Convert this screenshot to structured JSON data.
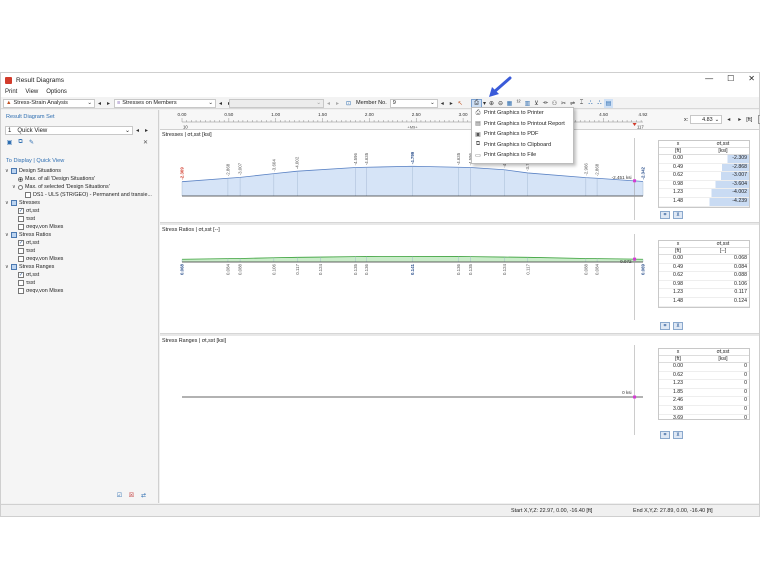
{
  "window": {
    "title": "Result Diagrams",
    "minimize": "—",
    "maximize": "☐",
    "close": "✕"
  },
  "menu": [
    "Print",
    "View",
    "Options"
  ],
  "toolbar": {
    "analysis_combo": "Stress-Strain Analysis",
    "stress_combo": "Stresses on Members",
    "member_label": "Member No.",
    "member_value": "9"
  },
  "dropdown": {
    "items": [
      {
        "label": "Print Graphics to Printer",
        "icon": "printer-icon"
      },
      {
        "label": "Print Graphics to Printout Report",
        "icon": "report-icon"
      },
      {
        "label": "Print Graphics to PDF",
        "icon": "pdf-icon"
      },
      {
        "label": "Print Graphics to Clipboard",
        "icon": "clipboard-icon"
      },
      {
        "label": "Print Graphics to File",
        "icon": "file-icon"
      }
    ]
  },
  "left": {
    "set_title": "Result Diagram Set",
    "set_value": "Quick View",
    "set_number": "1",
    "display_title": "To Display | Quick View",
    "tree": [
      {
        "label": "Design Situations",
        "level": 0,
        "type": "check",
        "state": "partial",
        "exp": "∨"
      },
      {
        "label": "Max. of all 'Design Situations'",
        "level": 1,
        "type": "radio",
        "state": "on"
      },
      {
        "label": "Max. of selected 'Design Situations'",
        "level": 1,
        "type": "radio",
        "state": "off",
        "exp": "∨"
      },
      {
        "label": "DS1 - ULS (STR/GEO) - Permanent and transie...",
        "level": 2,
        "type": "check",
        "state": "off"
      },
      {
        "label": "Stresses",
        "level": 0,
        "type": "check",
        "state": "partial",
        "exp": "∨"
      },
      {
        "label": "σt,sst",
        "level": 1,
        "type": "check",
        "state": "on"
      },
      {
        "label": "τsst",
        "level": 1,
        "type": "check",
        "state": "off"
      },
      {
        "label": "σeqv,von Mises",
        "level": 1,
        "type": "check",
        "state": "off"
      },
      {
        "label": "Stress Ratios",
        "level": 0,
        "type": "check",
        "state": "partial",
        "exp": "∨"
      },
      {
        "label": "σt,sst",
        "level": 1,
        "type": "check",
        "state": "on"
      },
      {
        "label": "τsst",
        "level": 1,
        "type": "check",
        "state": "off"
      },
      {
        "label": "σeqv,von Mises",
        "level": 1,
        "type": "check",
        "state": "off"
      },
      {
        "label": "Stress Ranges",
        "level": 0,
        "type": "check",
        "state": "partial",
        "exp": "∨"
      },
      {
        "label": "σt,sst",
        "level": 1,
        "type": "check",
        "state": "on"
      },
      {
        "label": "τsst",
        "level": 1,
        "type": "check",
        "state": "off"
      },
      {
        "label": "σeqv,von Mises",
        "level": 1,
        "type": "check",
        "state": "off"
      }
    ]
  },
  "ruler": {
    "ticks": [
      "0.00",
      "0.50",
      "1.00",
      "1.50",
      "2.00",
      "2.50",
      "3.00",
      "3.50",
      "4.00",
      "4.50",
      "4.92"
    ],
    "x_label": "x:",
    "x_value": "4.83",
    "unit": "[ft]",
    "start_node": "10",
    "end_node": "117",
    "member_mark": "+M9+"
  },
  "panels": [
    {
      "title": "Stresses | σt,sst [ksi]",
      "end_label": "-2.451 ksi",
      "table": {
        "col1": "x",
        "col1_unit": "[ft]",
        "col2": "σt,sst",
        "col2_unit": "[ksi]",
        "rows": [
          [
            "0.00",
            "-2.309"
          ],
          [
            "0.49",
            "-2.868"
          ],
          [
            "0.62",
            "-3.007"
          ],
          [
            "0.98",
            "-3.604"
          ],
          [
            "1.23",
            "-4.002"
          ],
          [
            "1.48",
            "-4.239"
          ],
          [
            "1.85",
            "-4.596"
          ],
          [
            "1.97",
            "-4.635"
          ],
          [
            "2.46",
            "-4.799"
          ]
        ]
      }
    },
    {
      "title": "Stress Ratios | σt,sst [--]",
      "end_label": "0.072",
      "table": {
        "col1": "x",
        "col1_unit": "[ft]",
        "col2": "σt,sst",
        "col2_unit": "[--]",
        "rows": [
          [
            "0.00",
            "0.068"
          ],
          [
            "0.49",
            "0.084"
          ],
          [
            "0.62",
            "0.088"
          ],
          [
            "0.98",
            "0.106"
          ],
          [
            "1.23",
            "0.117"
          ],
          [
            "1.48",
            "0.124"
          ],
          [
            "1.85",
            "0.135"
          ],
          [
            "1.97",
            "0.136"
          ],
          [
            "2.46",
            "0.141"
          ]
        ]
      }
    },
    {
      "title": "Stress Ranges | σt,sst [ksi]",
      "end_label": "0 ksi",
      "table": {
        "col1": "x",
        "col1_unit": "[ft]",
        "col2": "σt,sst",
        "col2_unit": "[ksi]",
        "rows": [
          [
            "0.00",
            "0"
          ],
          [
            "0.62",
            "0"
          ],
          [
            "1.23",
            "0"
          ],
          [
            "1.85",
            "0"
          ],
          [
            "2.46",
            "0"
          ],
          [
            "3.08",
            "0"
          ],
          [
            "3.69",
            "0"
          ],
          [
            "4.31",
            "0"
          ],
          [
            "4.92",
            "0"
          ]
        ]
      }
    }
  ],
  "chart_data": [
    {
      "type": "area",
      "title": "Stresses | σt,sst [ksi]",
      "x": [
        0.0,
        0.49,
        0.62,
        0.98,
        1.23,
        1.85,
        1.97,
        2.46,
        2.95,
        3.08,
        3.44,
        3.69,
        4.31,
        4.43,
        4.92
      ],
      "labels": [
        "-2.309",
        "-2.868",
        "-3.007",
        "-3.604",
        "-4.002",
        "-4.596",
        "-4.635",
        "-4.799",
        "-4.635",
        "-4.596",
        "-4.239",
        "-3.717",
        "-2.966",
        "-2.868",
        "-2.342"
      ],
      "values": [
        -2.309,
        -2.868,
        -3.007,
        -3.604,
        -4.002,
        -4.596,
        -4.635,
        -4.799,
        -4.635,
        -4.596,
        -4.239,
        -3.717,
        -2.966,
        -2.868,
        -2.342
      ],
      "end_value": -2.451,
      "xlim": [
        0,
        4.92
      ],
      "colors": {
        "fill": "#d6e4f7",
        "line": "#5a82c4",
        "extreme": "#d23b2b"
      }
    },
    {
      "type": "area",
      "title": "Stress Ratios | σt,sst [--]",
      "x": [
        0.0,
        0.49,
        0.62,
        0.98,
        1.23,
        1.48,
        1.85,
        1.97,
        2.46,
        2.95,
        3.08,
        3.44,
        3.69,
        4.31,
        4.43,
        4.92
      ],
      "labels": [
        "0.068",
        "0.084",
        "0.088",
        "0.106",
        "0.117",
        "0.124",
        "0.135",
        "0.136",
        "0.141",
        "0.136",
        "0.135",
        "0.124",
        "0.117",
        "0.088",
        "0.084",
        "0.069"
      ],
      "values": [
        0.068,
        0.084,
        0.088,
        0.106,
        0.117,
        0.124,
        0.135,
        0.136,
        0.141,
        0.136,
        0.135,
        0.124,
        0.117,
        0.088,
        0.084,
        0.069
      ],
      "end_value": 0.072,
      "xlim": [
        0,
        4.92
      ],
      "colors": {
        "fill": "#c9ecc9",
        "line": "#3aa03a"
      }
    },
    {
      "type": "line",
      "title": "Stress Ranges | σt,sst [ksi]",
      "x": [
        0.0,
        4.92
      ],
      "values": [
        0,
        0
      ],
      "end_value": 0,
      "xlim": [
        0,
        4.92
      ]
    }
  ],
  "status": {
    "start": "Start X,Y,Z: 22.97, 0.00, -16.40 [ft]",
    "end": "End X,Y,Z: 27.89, 0.00, -16.40 [ft]"
  }
}
